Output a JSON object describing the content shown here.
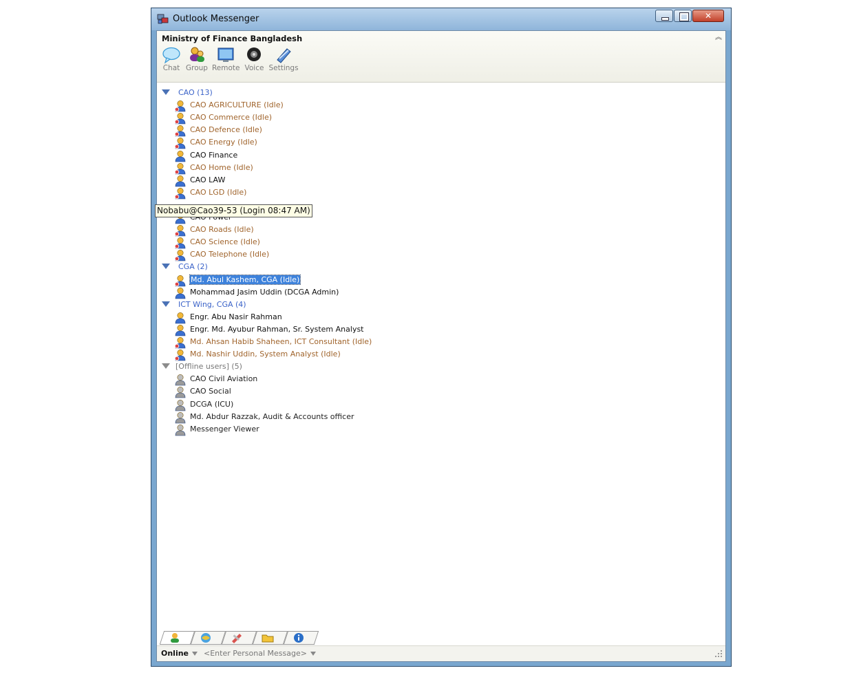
{
  "window": {
    "title": "Outlook Messenger",
    "controls": [
      "minimize",
      "maximize",
      "close"
    ]
  },
  "header": {
    "organization": "Ministry of Finance Bangladesh",
    "toolbar": [
      {
        "label": "Chat",
        "icon": "chat-icon"
      },
      {
        "label": "Group",
        "icon": "group-icon"
      },
      {
        "label": "Remote",
        "icon": "remote-icon"
      },
      {
        "label": "Voice",
        "icon": "voice-icon"
      },
      {
        "label": "Settings",
        "icon": "settings-icon"
      }
    ]
  },
  "contacts": {
    "groups": [
      {
        "label": "CAO (13)",
        "users": [
          {
            "name": "CAO AGRICULTURE (Idle)",
            "status": "idle"
          },
          {
            "name": "CAO Commerce (Idle)",
            "status": "idle"
          },
          {
            "name": "CAO Defence (Idle)",
            "status": "idle"
          },
          {
            "name": "CAO Energy (Idle)",
            "status": "idle"
          },
          {
            "name": "CAO Finance",
            "status": "online"
          },
          {
            "name": "CAO Home (Idle)",
            "status": "idle"
          },
          {
            "name": "CAO LAW",
            "status": "online"
          },
          {
            "name": "CAO LGD (Idle)",
            "status": "idle"
          },
          {
            "name": "CAO Power",
            "status": "online"
          },
          {
            "name": "CAO Roads (Idle)",
            "status": "idle"
          },
          {
            "name": "CAO Science (Idle)",
            "status": "idle"
          },
          {
            "name": "CAO Telephone (Idle)",
            "status": "idle"
          }
        ]
      },
      {
        "label": "CGA  (2)",
        "users": [
          {
            "name": "Md. Abul Kashem, CGA (Idle)",
            "status": "selected"
          },
          {
            "name": "Mohammad Jasim Uddin (DCGA Admin)",
            "status": "online"
          }
        ]
      },
      {
        "label": "ICT Wing, CGA  (4)",
        "users": [
          {
            "name": "Engr. Abu Nasir Rahman",
            "status": "online"
          },
          {
            "name": "Engr. Md. Ayubur Rahman, Sr. System Analyst",
            "status": "online"
          },
          {
            "name": "Md. Ahsan Habib Shaheen, ICT Consultant (Idle)",
            "status": "idle"
          },
          {
            "name": "Md. Nashir Uddin, System Analyst (Idle)",
            "status": "idle"
          }
        ]
      },
      {
        "label": "[Offline users] (5)",
        "users": [
          {
            "name": "CAO Civil Aviation",
            "status": "offline"
          },
          {
            "name": "CAO Social",
            "status": "offline"
          },
          {
            "name": "DCGA (ICU)",
            "status": "offline"
          },
          {
            "name": "Md. Abdur Razzak, Audit & Accounts officer",
            "status": "offline"
          },
          {
            "name": "Messenger Viewer",
            "status": "offline"
          }
        ]
      }
    ],
    "tooltip": "Nobabu@Cao39-53 (Login 08:47 AM)"
  },
  "bottom_tabs": [
    "contacts-tab-icon",
    "web-tab-icon",
    "tools-tab-icon",
    "folder-tab-icon",
    "info-tab-icon"
  ],
  "status": {
    "presence": "Online",
    "personal_message": "<Enter Personal Message>"
  }
}
